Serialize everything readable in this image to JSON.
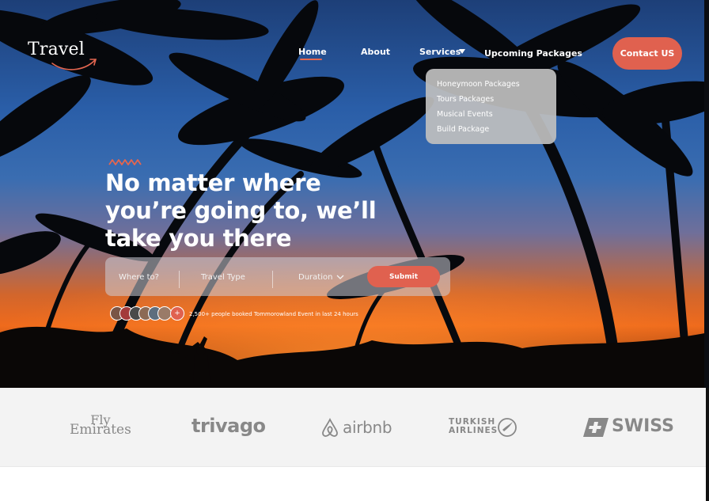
{
  "brand": {
    "logo_text": "Travel"
  },
  "nav": {
    "home": "Home",
    "about": "About",
    "services": "Services",
    "upcoming": "Upcoming Packages",
    "contact": "Contact US"
  },
  "services_menu": [
    "Honeymoon Packages",
    "Tours Packages",
    "Musical Events",
    "Build Package"
  ],
  "hero": {
    "headline": "No matter where you’re going to, we’ll take you there"
  },
  "search": {
    "where": "Where to?",
    "type": "Travel Type",
    "duration": "Duration",
    "submit": "Submit"
  },
  "social_proof": {
    "plus": "+",
    "text": "2,500+ people booked Tommorowland Event in last 24 hours"
  },
  "partners": {
    "emirates_top": "Fly",
    "emirates_bottom": "Emirates",
    "trivago": "trivago",
    "airbnb": "airbnb",
    "turkish_line1": "TURKISH",
    "turkish_line2": "AIRLINES",
    "swiss": "SWISS"
  },
  "colors": {
    "accent": "#e0614f",
    "partner_gray": "#888888"
  }
}
